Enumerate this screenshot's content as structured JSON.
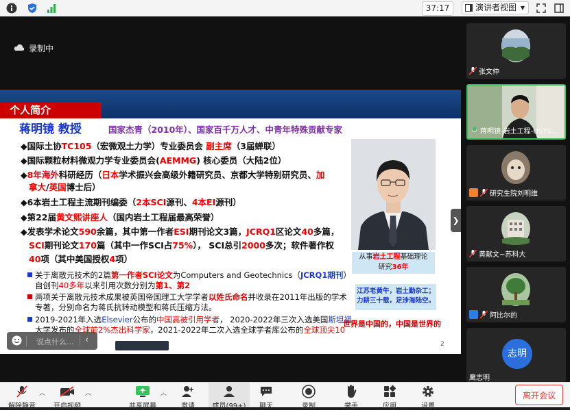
{
  "topbar": {
    "time": "37:17",
    "view_label": "演讲者视图"
  },
  "share": {
    "recording_label": "录制中"
  },
  "slide": {
    "section_title": "个人简介",
    "name": "蒋明镜 教授",
    "honors": "国家杰青（2010年）、国家百千万人才、中青年特殊贡献专家",
    "lines": [
      {
        "pre": "◆国际土协",
        "hl": "TC105",
        "post": "（宏微观土力学）专业委员会 ",
        "hl2": "副主席",
        "post2": "（3届蝉联）"
      },
      {
        "pre": "◆国际颗粒材料微观力学专业委员会(",
        "hl": "AEMMG",
        "post": ") 核心委员（大陆2位）"
      },
      {
        "pre": "◆",
        "hl": "8年海外",
        "post": "科研经历（",
        "hl2": "日本",
        "post2": "学术振兴会高级外籍研究员、京都大学特别研究员、",
        "hl3": "加"
      },
      {
        "cont": "拿大",
        "mid": "/",
        "hl": "英国",
        "post": "博士后）"
      },
      {
        "pre": "◆6本岩土工程主流期刊编委（",
        "hl": "2本SCI",
        "post": "源刊、",
        "hl2": "4本EI",
        "post2": "源刊）"
      },
      {
        "pre": "◆第22届",
        "hl": "黄文熙讲座人",
        "post": "（国内岩土工程届最高荣誉）"
      },
      {
        "pre": "◆发表学术论文",
        "hl": "590",
        "post": "余篇，其中第一作者",
        "hl2": "ESI",
        "post2": "期刊论文3篇，",
        "hl3": "JCRQ1",
        "post3": "区论文",
        "hl4": "40",
        "post4": "多篇，"
      },
      {
        "hl": "SCI",
        "post": "期刊论文",
        "hl2": "170",
        "post2": "篇（其中一作SCI占",
        "hl3": "75%",
        "post3": "）， SCI总引",
        "hl4": "2000",
        "post4": "多次；软件著作权"
      },
      {
        "hl": "40",
        "post": "项（其中美国授权",
        "hl2": "4",
        "post2": "项）"
      }
    ],
    "notes": [
      {
        "a": "关于离散元技术的2篇",
        "b": "第一作者SCI论文",
        "c": "为Computers and Geotechnics（",
        "d": "JCRQ1期刊",
        "e": "）"
      },
      {
        "a": "自创刊",
        "b": "40多年",
        "c": "以来引用次数分别为",
        "d": "第1、第2",
        "e": ""
      },
      {
        "a": "两项关于离散元技术成果被英国帝国理工大学学者",
        "b": "以姓氏命名",
        "c": "并收录在2011年出版的学术",
        "d": "",
        "e": ""
      },
      {
        "a": "专著，分别命名为蒋氏抗转动模型和蒋氏压缩方法。",
        "b": "",
        "c": "",
        "d": "",
        "e": ""
      },
      {
        "a": "2019-2021年入选",
        "b": "Elsevier",
        "c": "公布的",
        "d": "中国高被引用学者",
        "e": "， 2020-2022年三次入选美国",
        "f": "斯坦福"
      },
      {
        "a": "大学发布的",
        "b": "全球前2%杰出科学家",
        "c": "，2021-2022年二次入选全球学者库公布的",
        "d": "全球顶尖10",
        "e": ""
      }
    ],
    "photo_caption_pre": "从事",
    "photo_caption_hl": "岩土工程",
    "photo_caption_post": "基础理论",
    "photo_caption_line2": "研究",
    "photo_caption_years": "36年",
    "motto_line1": "江苏老黄牛，岩土勤杂工；",
    "motto_line2": "力耕三十载，足涉海陆空。",
    "slogan": "世界是中国的，中国是世界的",
    "page_number": "2"
  },
  "chat": {
    "placeholder": "说点什么..."
  },
  "participants": [
    {
      "name": "张文仲",
      "type": "landscape"
    },
    {
      "name": "蒋明镜-岩土工程-USTS...",
      "type": "video"
    },
    {
      "name": "研究生院刘明维",
      "type": "dog"
    },
    {
      "name": "黄献文~苏科大",
      "type": "building"
    },
    {
      "name": "阿比尔的",
      "type": "tree"
    },
    {
      "name": "鹰志明",
      "type": "avatar",
      "avatar_text": "志明"
    }
  ],
  "toolbar": {
    "items": [
      "解除静音",
      "开启视频",
      "共享屏幕",
      "邀请",
      "成员(99+)",
      "聊天",
      "录制",
      "举手",
      "应用",
      "设置"
    ],
    "end_label": "离开会议"
  },
  "colors": {
    "accent_red": "#e00000",
    "accent_blue": "#1a39c9",
    "end_red": "#e33333"
  }
}
